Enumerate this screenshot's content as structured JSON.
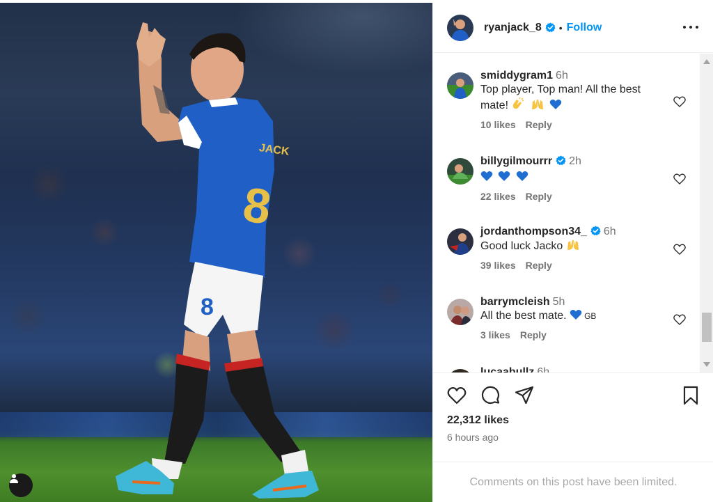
{
  "post": {
    "username": "ryanjack_8",
    "follow_label": "Follow",
    "separator": "•",
    "likes": "22,312 likes",
    "time_ago": "6 hours ago",
    "comments_limited": "Comments on this post have been limited."
  },
  "comments": [
    {
      "user": "smiddygram1",
      "time": "6h",
      "text_line1": "Top player, Top man! All the best",
      "text_line2": "mate!",
      "likes": "10 likes",
      "reply": "Reply",
      "verified": false
    },
    {
      "user": "billygilmourrr",
      "time": "2h",
      "text": "",
      "likes": "22 likes",
      "reply": "Reply",
      "verified": true
    },
    {
      "user": "jordanthompson34_",
      "time": "6h",
      "text": "Good luck Jacko",
      "likes": "39 likes",
      "reply": "Reply",
      "verified": true
    },
    {
      "user": "barrymcleish",
      "time": "5h",
      "text": "All the best mate.",
      "suffix": "GB",
      "likes": "3 likes",
      "reply": "Reply",
      "verified": false
    },
    {
      "user": "lucaabullz",
      "time": "6h"
    }
  ],
  "colors": {
    "link_blue": "#0095f6",
    "verified_blue": "#0095f6",
    "rangers_blue": "#1f5fc6",
    "heart_blue": "#1e6fd1"
  },
  "icons": [
    "more-icon",
    "heart-icon",
    "comment-icon",
    "share-icon",
    "bookmark-icon",
    "user-icon",
    "verified-icon"
  ]
}
